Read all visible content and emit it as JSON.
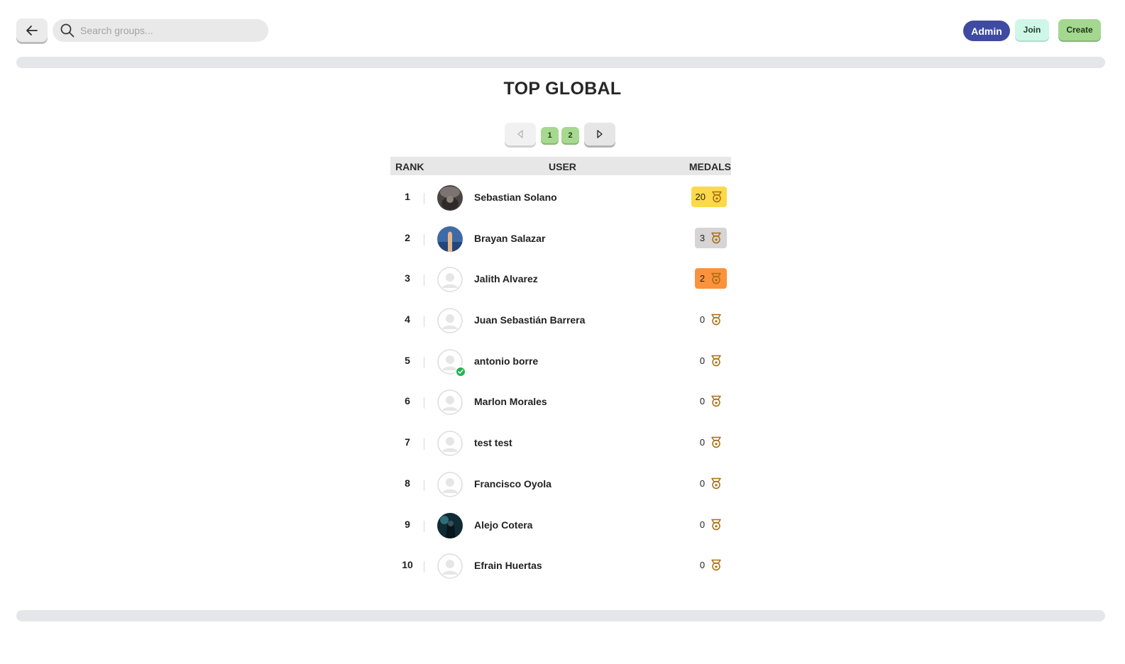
{
  "header": {
    "search_placeholder": "Search groups...",
    "admin_label": "Admin",
    "join_label": "Join",
    "create_label": "Create"
  },
  "title": "TOP GLOBAL",
  "pagination": {
    "pages": [
      "1",
      "2"
    ]
  },
  "table": {
    "columns": {
      "rank": "RANK",
      "user": "USER",
      "medals": "MEDALS"
    },
    "rows": [
      {
        "rank": "1",
        "name": "Sebastian Solano",
        "medals": "20",
        "avatar": "photo-dark",
        "highlight": "#fbd94a"
      },
      {
        "rank": "2",
        "name": "Brayan Salazar",
        "medals": "3",
        "avatar": "photo-sky",
        "highlight": "#d6d4d4"
      },
      {
        "rank": "3",
        "name": "Jalith Alvarez",
        "medals": "2",
        "avatar": "default",
        "highlight": "#fb923c"
      },
      {
        "rank": "4",
        "name": "Juan Sebastián Barrera",
        "medals": "0",
        "avatar": "default",
        "highlight": ""
      },
      {
        "rank": "5",
        "name": "antonio borre",
        "medals": "0",
        "avatar": "default-verified",
        "highlight": ""
      },
      {
        "rank": "6",
        "name": "Marlon Morales",
        "medals": "0",
        "avatar": "default",
        "highlight": ""
      },
      {
        "rank": "7",
        "name": "test test",
        "medals": "0",
        "avatar": "default",
        "highlight": ""
      },
      {
        "rank": "8",
        "name": "Francisco Oyola",
        "medals": "0",
        "avatar": "default",
        "highlight": ""
      },
      {
        "rank": "9",
        "name": "Alejo Cotera",
        "medals": "0",
        "avatar": "photo-night",
        "highlight": ""
      },
      {
        "rank": "10",
        "name": "Efrain Huertas",
        "medals": "0",
        "avatar": "default",
        "highlight": ""
      }
    ]
  },
  "colors": {
    "admin": "#3f4aa2",
    "join": "#cff7e8",
    "create": "#a4d890",
    "page_button": "#a6d98f",
    "medal_icon": "#b8860b"
  },
  "icons": {
    "back": "arrow-left-icon",
    "search": "search-icon",
    "prev": "triangle-left-icon",
    "next": "triangle-right-icon",
    "medal": "medal-icon",
    "verified": "check-badge-icon"
  }
}
